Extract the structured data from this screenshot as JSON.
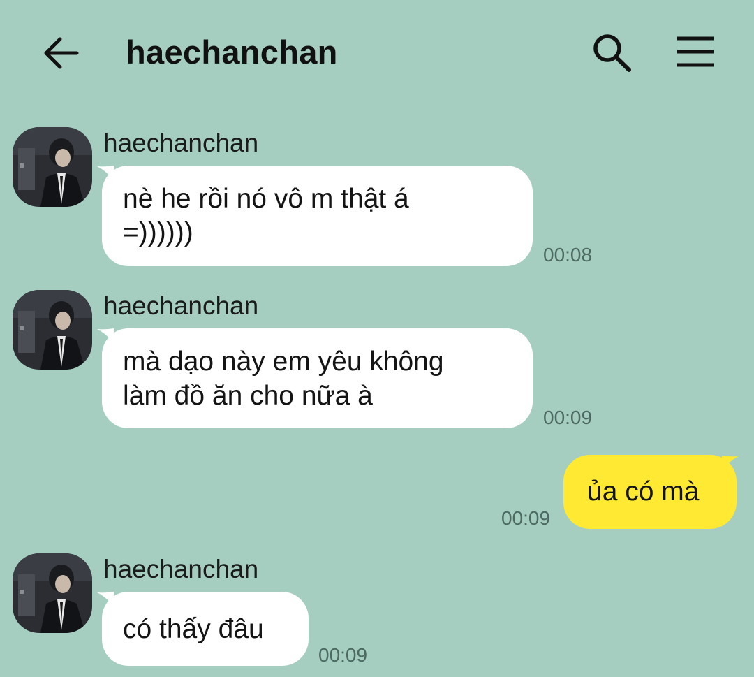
{
  "header": {
    "title": "haechanchan",
    "back_icon": "arrow-left-icon",
    "search_icon": "search-icon",
    "menu_icon": "hamburger-menu-icon"
  },
  "colors": {
    "background": "#a5cec1",
    "incoming_bubble": "#ffffff",
    "outgoing_bubble": "#ffe932"
  },
  "messages": [
    {
      "direction": "incoming",
      "sender": "haechanchan",
      "lines": [
        "nè he rồi nó vô m thật á",
        "=))))))"
      ],
      "time": "00:08"
    },
    {
      "direction": "incoming",
      "sender": "haechanchan",
      "lines": [
        "mà dạo này em yêu không",
        "làm đồ ăn cho nữa à"
      ],
      "time": "00:09"
    },
    {
      "direction": "outgoing",
      "lines": [
        "ủa có mà"
      ],
      "time": "00:09"
    },
    {
      "direction": "incoming",
      "sender": "haechanchan",
      "lines": [
        "có thấy đâu"
      ],
      "time": "00:09"
    }
  ]
}
